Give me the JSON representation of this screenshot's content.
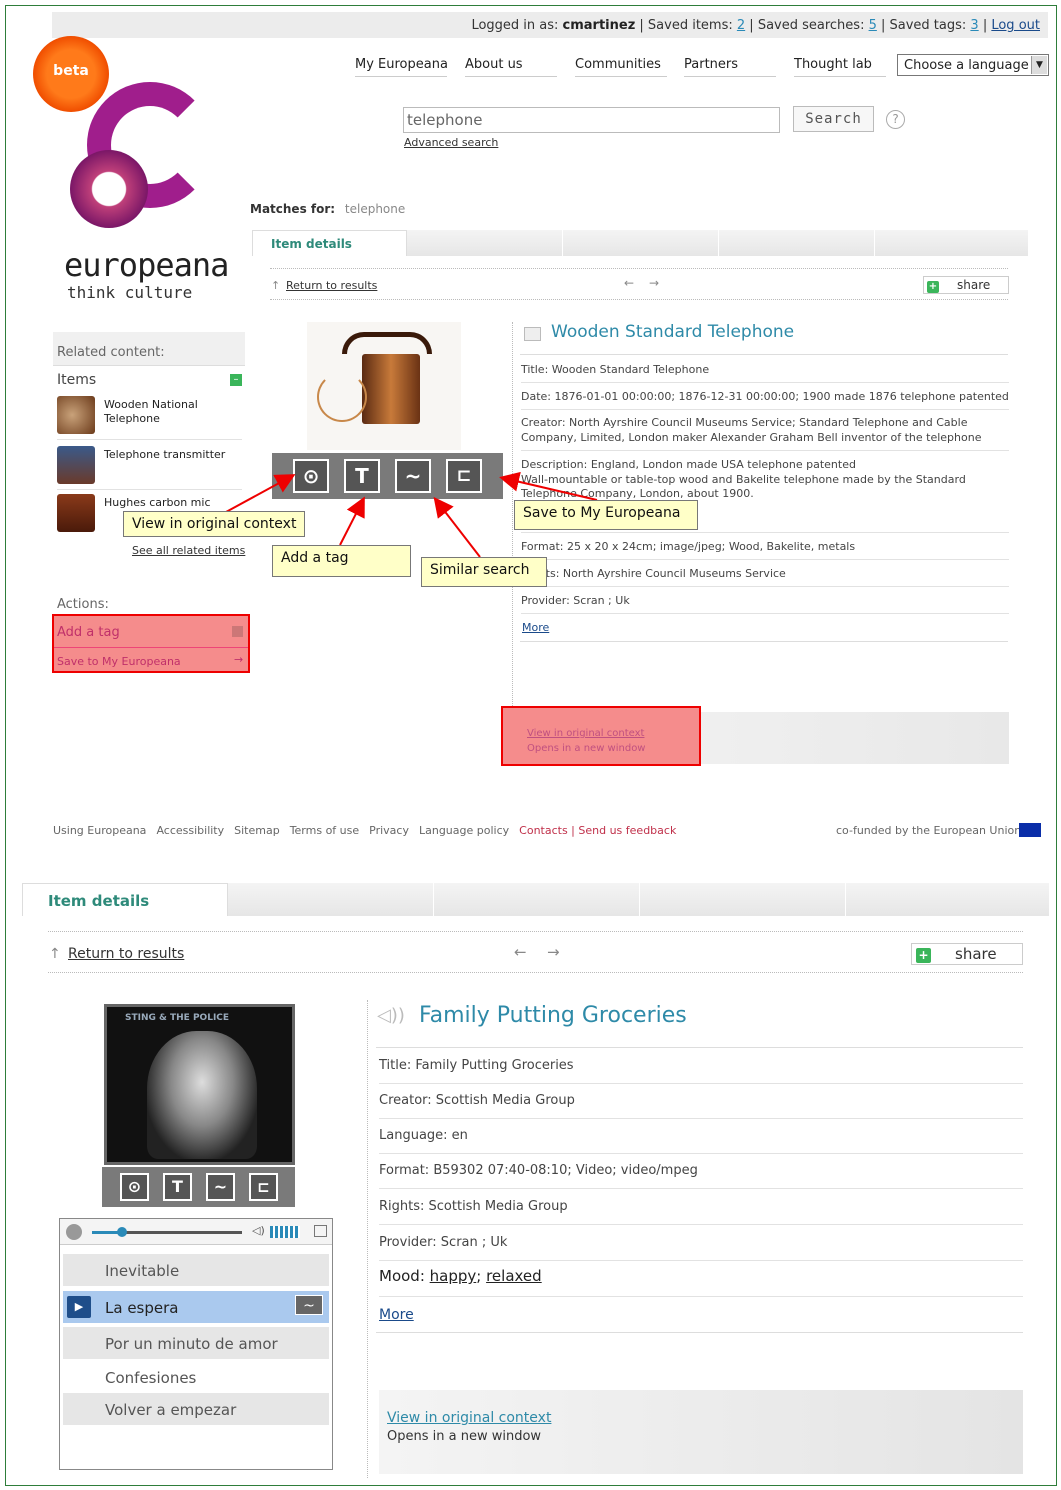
{
  "topbar": {
    "logged_prefix": "Logged in as: ",
    "user": "cmartinez",
    "saved_items_label": " | Saved items: ",
    "saved_items": "2",
    "saved_searches_label": " | Saved searches: ",
    "saved_searches": "5",
    "saved_tags_label": " | Saved tags: ",
    "saved_tags": "3",
    "sep": " | ",
    "logout": "Log out"
  },
  "logo": {
    "badge": "beta",
    "word": "europeana",
    "tagline": "think culture"
  },
  "nav": [
    "My Europeana",
    "About us",
    "Communities",
    "Partners",
    "Thought lab"
  ],
  "language_select": "Choose a language",
  "search": {
    "value": "telephone",
    "button": "Search",
    "help": "?",
    "advanced": "Advanced search"
  },
  "matches": {
    "label": "Matches for:",
    "query": "telephone"
  },
  "sidebar": {
    "related_heading": "Related content:",
    "items_heading": "Items",
    "items": [
      {
        "title": "Wooden National Telephone"
      },
      {
        "title": "Telephone transmitter"
      },
      {
        "title": "Hughes carbon mic"
      }
    ],
    "see_all": "See all related items",
    "actions_heading": "Actions:",
    "actions": [
      "Add a tag",
      "Save to My Europeana"
    ]
  },
  "item1": {
    "tab": "Item details",
    "return": "Return to results",
    "share": "share",
    "title": "Wooden Standard Telephone",
    "fields": [
      "Title: Wooden Standard Telephone",
      "Date: 1876-01-01 00:00:00;  1876-12-31 00:00:00;  1900 made 1876 telephone patented",
      "Creator: North Ayrshire Council Museums Service;  Standard Telephone and Cable",
      "Company, Limited, London maker Alexander Graham Bell inventor of the telephone",
      "Description: England, London made USA telephone patented",
      "Wall-mountable or table-top wood and Bakelite telephone made by the Standard",
      "Telephone Company, London, about 1900.",
      "Format: 25 x 20 x 24cm;  image/jpeg;  Wood, Bakelite, metals",
      "Rights: North Ayrshire Council Museums Service",
      "Provider: Scran ;  Uk"
    ],
    "more": "More",
    "view_original": "View in original context",
    "opens_new": "Opens in a new window"
  },
  "callouts": {
    "view_original": "View in original context",
    "add_tag": "Add a tag",
    "similar": "Similar search",
    "save": "Save to My Europeana"
  },
  "footer": {
    "links": [
      "Using Europeana",
      "Accessibility",
      "Sitemap",
      "Terms of use",
      "Privacy",
      "Language policy"
    ],
    "contacts": "Contacts | Send us feedback",
    "eu": "co-funded by the European Union"
  },
  "item2": {
    "tab": "Item details",
    "return": "Return to results",
    "share": "share",
    "title": "Family Putting Groceries",
    "cover_text": "STING & THE POLICE",
    "fields": [
      "Title: Family Putting Groceries",
      "Creator: Scottish Media Group",
      "Language: en",
      "Format: B59302 07:40-08:10;  Video;  video/mpeg",
      "Rights: Scottish Media Group",
      "Provider: Scran ;  Uk"
    ],
    "mood_label": "Mood: ",
    "mood_values": [
      "happy",
      "relaxed"
    ],
    "mood_sep": "; ",
    "more": "More",
    "view_original": "View in original context",
    "opens_new": "Opens in a new window",
    "tracks": [
      "Inevitable",
      "La espera",
      "Por un minuto de amor",
      "Confesiones",
      "Volver a empezar"
    ],
    "active_track_index": 1,
    "progress": 0.2
  },
  "colors": {
    "accent_teal": "#2e8a7a",
    "link_blue": "#1a4a8a",
    "highlight_red": "#f58c8c",
    "logo_purple": "#a01e8c"
  }
}
